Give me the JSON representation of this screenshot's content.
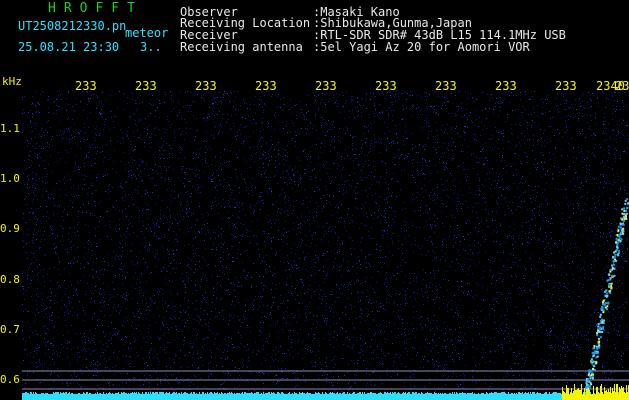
{
  "header": {
    "logo": "HROFFT",
    "filename": "UT2508212330.pn",
    "meteor_label": "meteor",
    "datetime": "25.08.21 23:30",
    "count": "3..",
    "fields": [
      {
        "label": "Observer",
        "value": ":Masaki Kano"
      },
      {
        "label": "Receiving Location",
        "value": ":Shibukawa,Gunma,Japan"
      },
      {
        "label": "Receiver",
        "value": ":RTL-SDR SDR# 43dB L15 114.1MHz USB"
      },
      {
        "label": "Receiving antenna",
        "value": ":5el Yagi Az 20 for Aomori VOR"
      }
    ]
  },
  "chart_data": {
    "type": "heatmap",
    "title": "",
    "ylabel": "kHz",
    "yticks": [
      "1.1",
      "1.0",
      "0.9",
      "0.8",
      "0.7",
      "0.6"
    ],
    "xticks": [
      "233",
      "233",
      "233",
      "233",
      "233",
      "233",
      "233",
      "233",
      "233",
      "233",
      "2340"
    ],
    "ylim": [
      0.56,
      1.2
    ],
    "meteor_trace": {
      "start": [
        0.93,
        0.58
      ],
      "end": [
        0.995,
        0.96
      ]
    }
  },
  "colors": {
    "background": "#000000",
    "plot_noise": "#0a1a8c",
    "text_yellow": "#f5f500",
    "text_green": "#19d219",
    "text_cyan": "#2ee0ff",
    "trace": "#66ccff"
  }
}
